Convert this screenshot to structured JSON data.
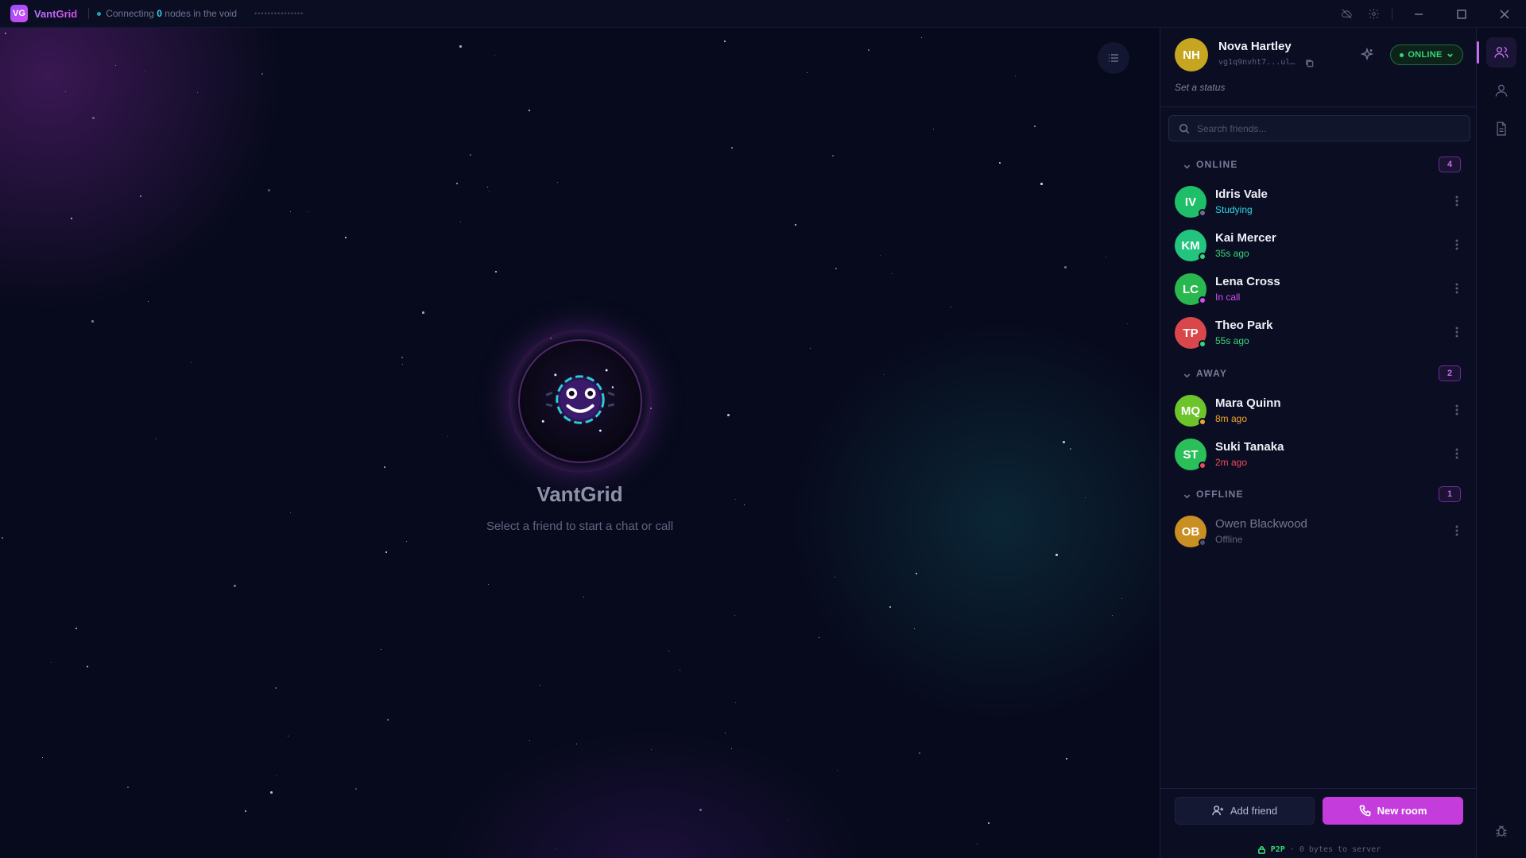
{
  "titlebar": {
    "logo_text": "VG",
    "app_name": "VantGrid",
    "conn_prefix": "Connecting",
    "conn_count": "0",
    "conn_suffix": "nodes in the void",
    "dots": "•••••••••••••••"
  },
  "main": {
    "title": "VantGrid",
    "subtitle": "Select a friend to start a chat or call"
  },
  "profile": {
    "initials": "NH",
    "name": "Nova Hartley",
    "id": "vg1q9nvht7...ul…",
    "status_prompt": "Set a status",
    "presence": "ONLINE"
  },
  "search": {
    "placeholder": "Search friends..."
  },
  "groups": [
    {
      "title": "ONLINE",
      "count": "4"
    },
    {
      "title": "AWAY",
      "count": "2"
    },
    {
      "title": "OFFLINE",
      "count": "1"
    }
  ],
  "friends": [
    {
      "initials": "IV",
      "name": "Idris Vale",
      "sub": "Studying",
      "avatar_color": "#1fbf6a",
      "sub_color": "#2fd4e4",
      "presence_color": "#6b7090"
    },
    {
      "initials": "KM",
      "name": "Kai Mercer",
      "sub": "35s ago",
      "avatar_color": "#22c47e",
      "sub_color": "#35d677",
      "presence_color": "#35d677"
    },
    {
      "initials": "LC",
      "name": "Lena Cross",
      "sub": "In call",
      "avatar_color": "#28b84f",
      "sub_color": "#d04ff0",
      "presence_color": "#d04ff0"
    },
    {
      "initials": "TP",
      "name": "Theo Park",
      "sub": "55s ago",
      "avatar_color": "#d9474a",
      "sub_color": "#35d677",
      "presence_color": "#35d677"
    },
    {
      "initials": "MQ",
      "name": "Mara Quinn",
      "sub": "8m ago",
      "avatar_color": "#6dc42a",
      "sub_color": "#f0a52a",
      "presence_color": "#f0a52a"
    },
    {
      "initials": "ST",
      "name": "Suki Tanaka",
      "sub": "2m ago",
      "avatar_color": "#2bbf5a",
      "sub_color": "#f04a5a",
      "presence_color": "#f04a5a"
    },
    {
      "initials": "OB",
      "name": "Owen Blackwood",
      "sub": "Offline",
      "avatar_color": "#c98f23",
      "sub_color": "#5f6580",
      "presence_color": "#4b5070"
    }
  ],
  "footer": {
    "add_friend": "Add friend",
    "new_room": "New room",
    "p2p_label": "P2P",
    "p2p_sep": "·",
    "p2p_text": "0 bytes to server"
  }
}
